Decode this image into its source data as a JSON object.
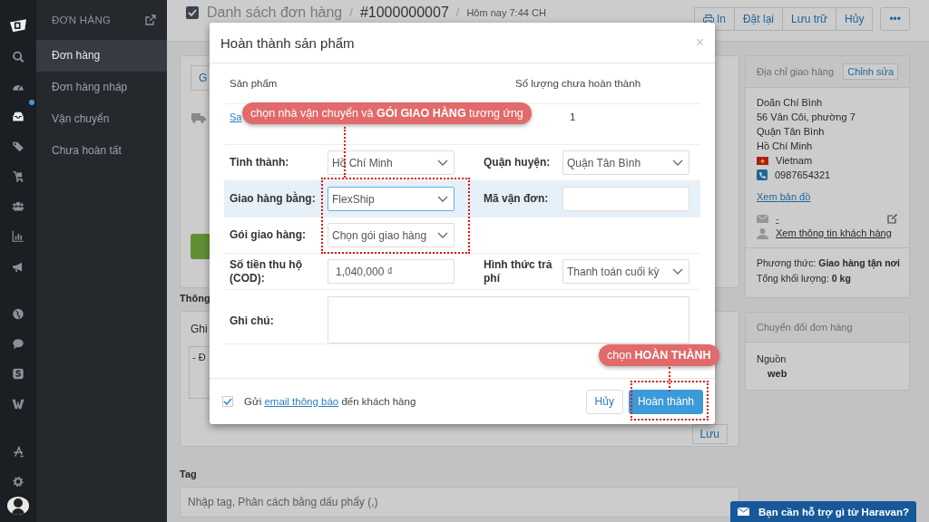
{
  "sidebar": {
    "section_title": "ĐƠN HÀNG",
    "items": [
      {
        "label": "Đơn hàng",
        "selected": true
      },
      {
        "label": "Đơn hàng nháp",
        "selected": false
      },
      {
        "label": "Vận chuyển",
        "selected": false
      },
      {
        "label": "Chưa hoàn tất",
        "selected": false
      }
    ]
  },
  "header": {
    "breadcrumb": "Danh sách đơn hàng",
    "separators": [
      "/",
      "/"
    ],
    "order_number": "#1000000007",
    "timestamp": "Hôm nay 7:44 CH",
    "actions": [
      "In",
      "Đặt lại",
      "Lưu trữ",
      "Hủy",
      "•••"
    ]
  },
  "background": {
    "first_button": "G",
    "notes_heading": "Thông",
    "notes_label": "Ghi",
    "notes_text": "- Đ",
    "save_button": "Lưu",
    "tag_heading": "Tag",
    "tag_placeholder": "Nhập tag, Phân cách bằng dấu phẩy (,)"
  },
  "shipping_address": {
    "title": "Địa chỉ giao hàng",
    "edit": "Chỉnh sửa",
    "lines": [
      "Doãn Chí Bình",
      "56 Vân Côi, phường 7",
      "Quận Tân Bình",
      "Hồ Chí Minh"
    ],
    "country": "Vietnam",
    "phone": "0987654321",
    "map_link": "Xem bản đồ",
    "email": "-",
    "customer_link": "Xem thông tin khách hàng",
    "method": "Phương thức: **Giao hàng tận nơi**",
    "weight": "Tổng khối lượng: **0 kg**"
  },
  "conversion": {
    "title": "Chuyển đổi đơn hàng",
    "source_label": "Nguồn",
    "source_value": "web"
  },
  "modal": {
    "title": "Hoàn thành sản phẩm",
    "close": "×",
    "columns": [
      "Sản phẩm",
      "Số lượng chưa hoàn thành"
    ],
    "product": {
      "name": "Sa",
      "quantity": "1"
    },
    "rows": [
      {
        "highlighted": false,
        "fields": [
          {
            "label": "Tỉnh thành:",
            "kind": "select",
            "value": "Hồ Chí Minh",
            "focused": false
          },
          {
            "label": "Quận huyện:",
            "kind": "select",
            "value": "Quận Tân Bình",
            "focused": false
          }
        ]
      },
      {
        "highlighted": true,
        "fields": [
          {
            "label": "Giao hàng bằng:",
            "kind": "select",
            "value": "FlexShip",
            "focused": true
          },
          {
            "label": "Mã vận đơn:",
            "kind": "input",
            "focused": false
          }
        ]
      },
      {
        "highlighted": false,
        "fields": [
          {
            "label": "Gói giao hàng:",
            "kind": "select",
            "value": "Chọn gói giao hàng",
            "focused": false
          }
        ]
      },
      {
        "highlighted": false,
        "fields": [
          {
            "label": "Số tiền thu hộ (COD):",
            "kind": "input",
            "value": "1,040,000 ₫",
            "focused": false
          },
          {
            "label": "Hình thức trả phí",
            "kind": "select",
            "value": "Thanh toán cuối kỳ",
            "focused": false
          }
        ]
      },
      {
        "highlighted": false,
        "fields": [
          {
            "label": "Ghi chú:",
            "kind": "textarea",
            "focused": false
          }
        ]
      }
    ],
    "send_email": {
      "checked": true,
      "before": "Gửi",
      "link": "email thông báo",
      "after": "đến khách hàng"
    },
    "buttons": [
      {
        "label": "Hủy",
        "kind": "secondary"
      },
      {
        "label": "Hoàn thành",
        "kind": "primary"
      }
    ]
  },
  "callouts": [
    {
      "text": "chọn nhà vận chuyển và **GÓI GIAO HÀNG** tương ứng"
    },
    {
      "text": "chọn **HOÀN THÀNH**"
    }
  ],
  "help_chat": {
    "label": "Bạn cần hỗ trợ gì từ Haravan?"
  }
}
